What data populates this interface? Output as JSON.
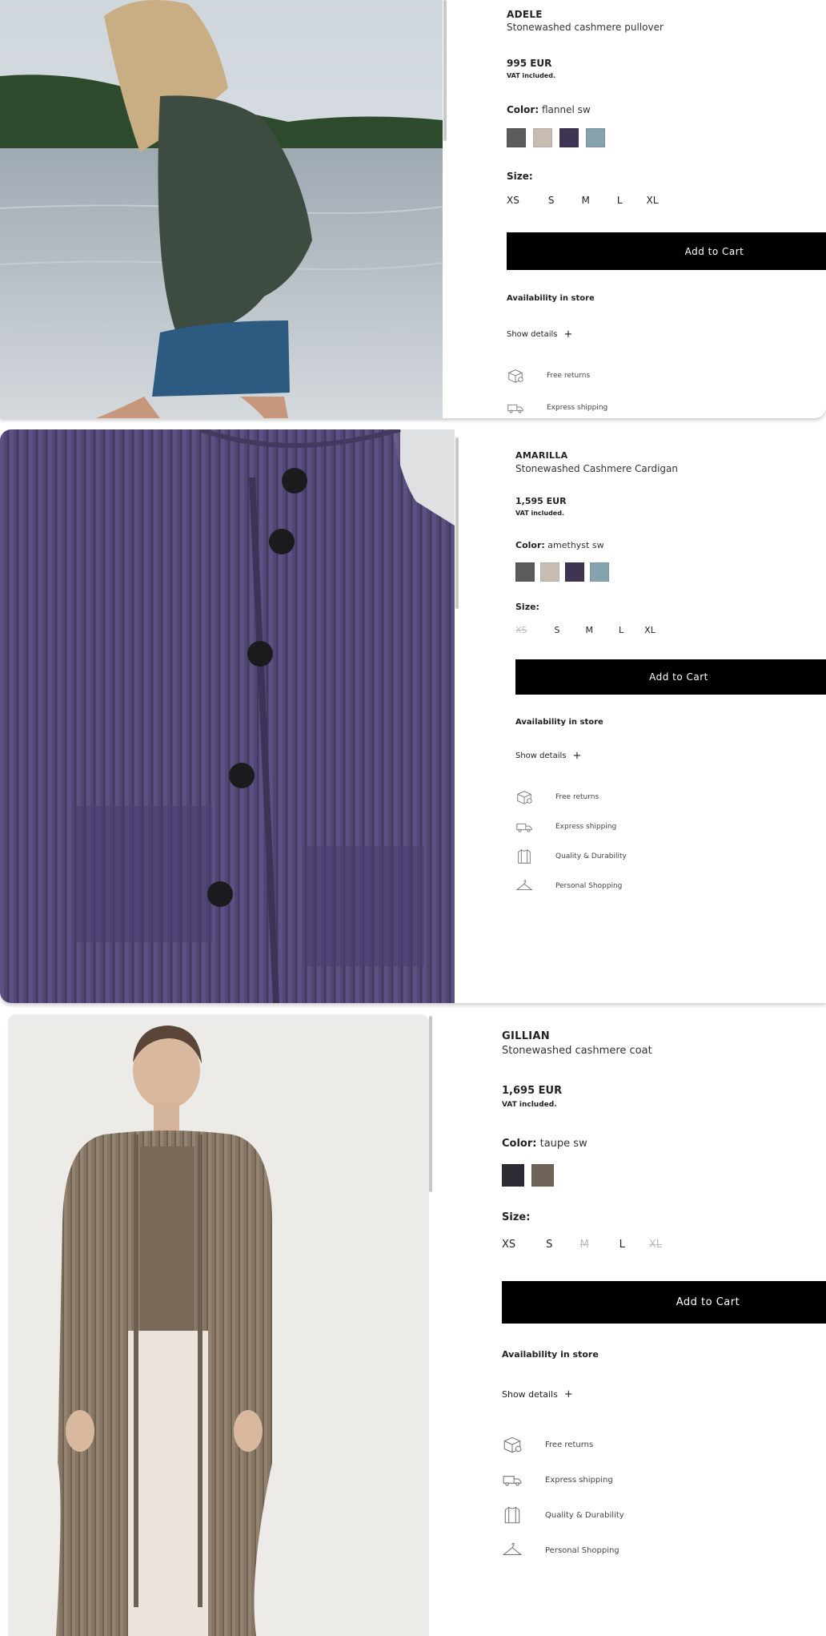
{
  "products": [
    {
      "brand": "ADELE",
      "name": "Stonewashed cashmere pullover",
      "price": "995 EUR",
      "vat": "VAT included.",
      "color_label": "Color:",
      "color_value": "flannel sw",
      "swatches": [
        "#5b5b5b",
        "#c7bcb2",
        "#3f3451",
        "#86a2ac"
      ],
      "size_label": "Size:",
      "sizes": [
        {
          "label": "XS",
          "available": true
        },
        {
          "label": "S",
          "available": true
        },
        {
          "label": "M",
          "available": true
        },
        {
          "label": "L",
          "available": true
        },
        {
          "label": "XL",
          "available": true
        }
      ],
      "cart_label": "Add to Cart",
      "availability": "Availability in store",
      "show_details": "Show details",
      "plus": "+",
      "features": [
        "Free returns",
        "Express shipping"
      ],
      "feature_icons": [
        "box-icon",
        "truck-icon"
      ]
    },
    {
      "brand": "AMARILLA",
      "name": "Stonewashed Cashmere Cardigan",
      "price": "1,595 EUR",
      "vat": "VAT included.",
      "color_label": "Color:",
      "color_value": "amethyst sw",
      "swatches": [
        "#5b5b5b",
        "#c7bcb2",
        "#3f3451",
        "#86a2ac"
      ],
      "size_label": "Size:",
      "sizes": [
        {
          "label": "XS",
          "available": false
        },
        {
          "label": "S",
          "available": true
        },
        {
          "label": "M",
          "available": true
        },
        {
          "label": "L",
          "available": true
        },
        {
          "label": "XL",
          "available": true
        }
      ],
      "cart_label": "Add to Cart",
      "availability": "Availability in store",
      "show_details": "Show details",
      "plus": "+",
      "features": [
        "Free returns",
        "Express shipping",
        "Quality & Durability",
        "Personal Shopping"
      ],
      "feature_icons": [
        "box-icon",
        "truck-icon",
        "sweater-icon",
        "hanger-icon"
      ]
    },
    {
      "brand": "GILLIAN",
      "name": "Stonewashed cashmere coat",
      "price": "1,695 EUR",
      "vat": "VAT included.",
      "color_label": "Color:",
      "color_value": "taupe sw",
      "swatches": [
        "#2b2b33",
        "#6f6458"
      ],
      "size_label": "Size:",
      "sizes": [
        {
          "label": "XS",
          "available": true
        },
        {
          "label": "S",
          "available": true
        },
        {
          "label": "M",
          "available": false
        },
        {
          "label": "L",
          "available": true
        },
        {
          "label": "XL",
          "available": false
        }
      ],
      "cart_label": "Add to Cart",
      "availability": "Availability in store",
      "show_details": "Show details",
      "plus": "+",
      "features": [
        "Free returns",
        "Express shipping",
        "Quality & Durability",
        "Personal Shopping"
      ],
      "feature_icons": [
        "box-icon",
        "truck-icon",
        "sweater-icon",
        "hanger-icon"
      ]
    }
  ]
}
